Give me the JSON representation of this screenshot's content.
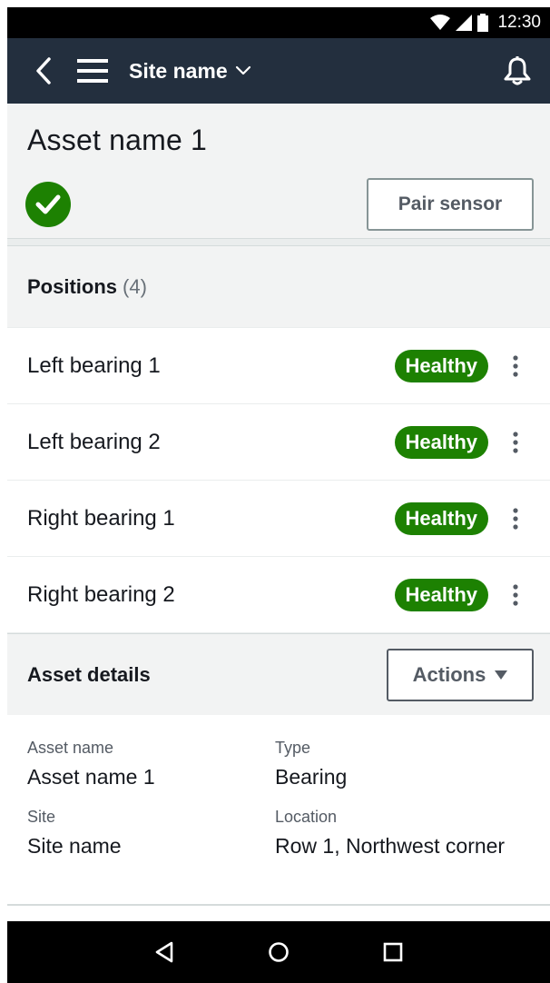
{
  "status_bar": {
    "time": "12:30"
  },
  "top_nav": {
    "site_name": "Site name"
  },
  "asset_header": {
    "title": "Asset name 1",
    "pair_sensor_label": "Pair sensor",
    "status_color": "#1d8102"
  },
  "positions": {
    "title": "Positions",
    "count": "(4)",
    "items": [
      {
        "name": "Left bearing 1",
        "status": "Healthy"
      },
      {
        "name": "Left bearing 2",
        "status": "Healthy"
      },
      {
        "name": "Right bearing 1",
        "status": "Healthy"
      },
      {
        "name": "Right bearing 2",
        "status": "Healthy"
      }
    ]
  },
  "asset_details": {
    "title": "Asset details",
    "actions_label": "Actions",
    "fields": [
      {
        "label": "Asset name",
        "value": "Asset name 1"
      },
      {
        "label": "Type",
        "value": "Bearing"
      },
      {
        "label": "Site",
        "value": "Site name"
      },
      {
        "label": "Location",
        "value": "Row 1, Northwest corner"
      }
    ]
  },
  "colors": {
    "nav_bg": "#232f3e",
    "healthy": "#1d8102",
    "header_bg": "#f2f3f3"
  },
  "icons": [
    "wifi-icon",
    "signal-icon",
    "battery-icon",
    "back-arrow-icon",
    "menu-icon",
    "chevron-down-icon",
    "bell-icon",
    "checkmark-icon",
    "kebab-icon",
    "caret-down-icon",
    "nav-back-icon",
    "nav-home-icon",
    "nav-recents-icon"
  ]
}
